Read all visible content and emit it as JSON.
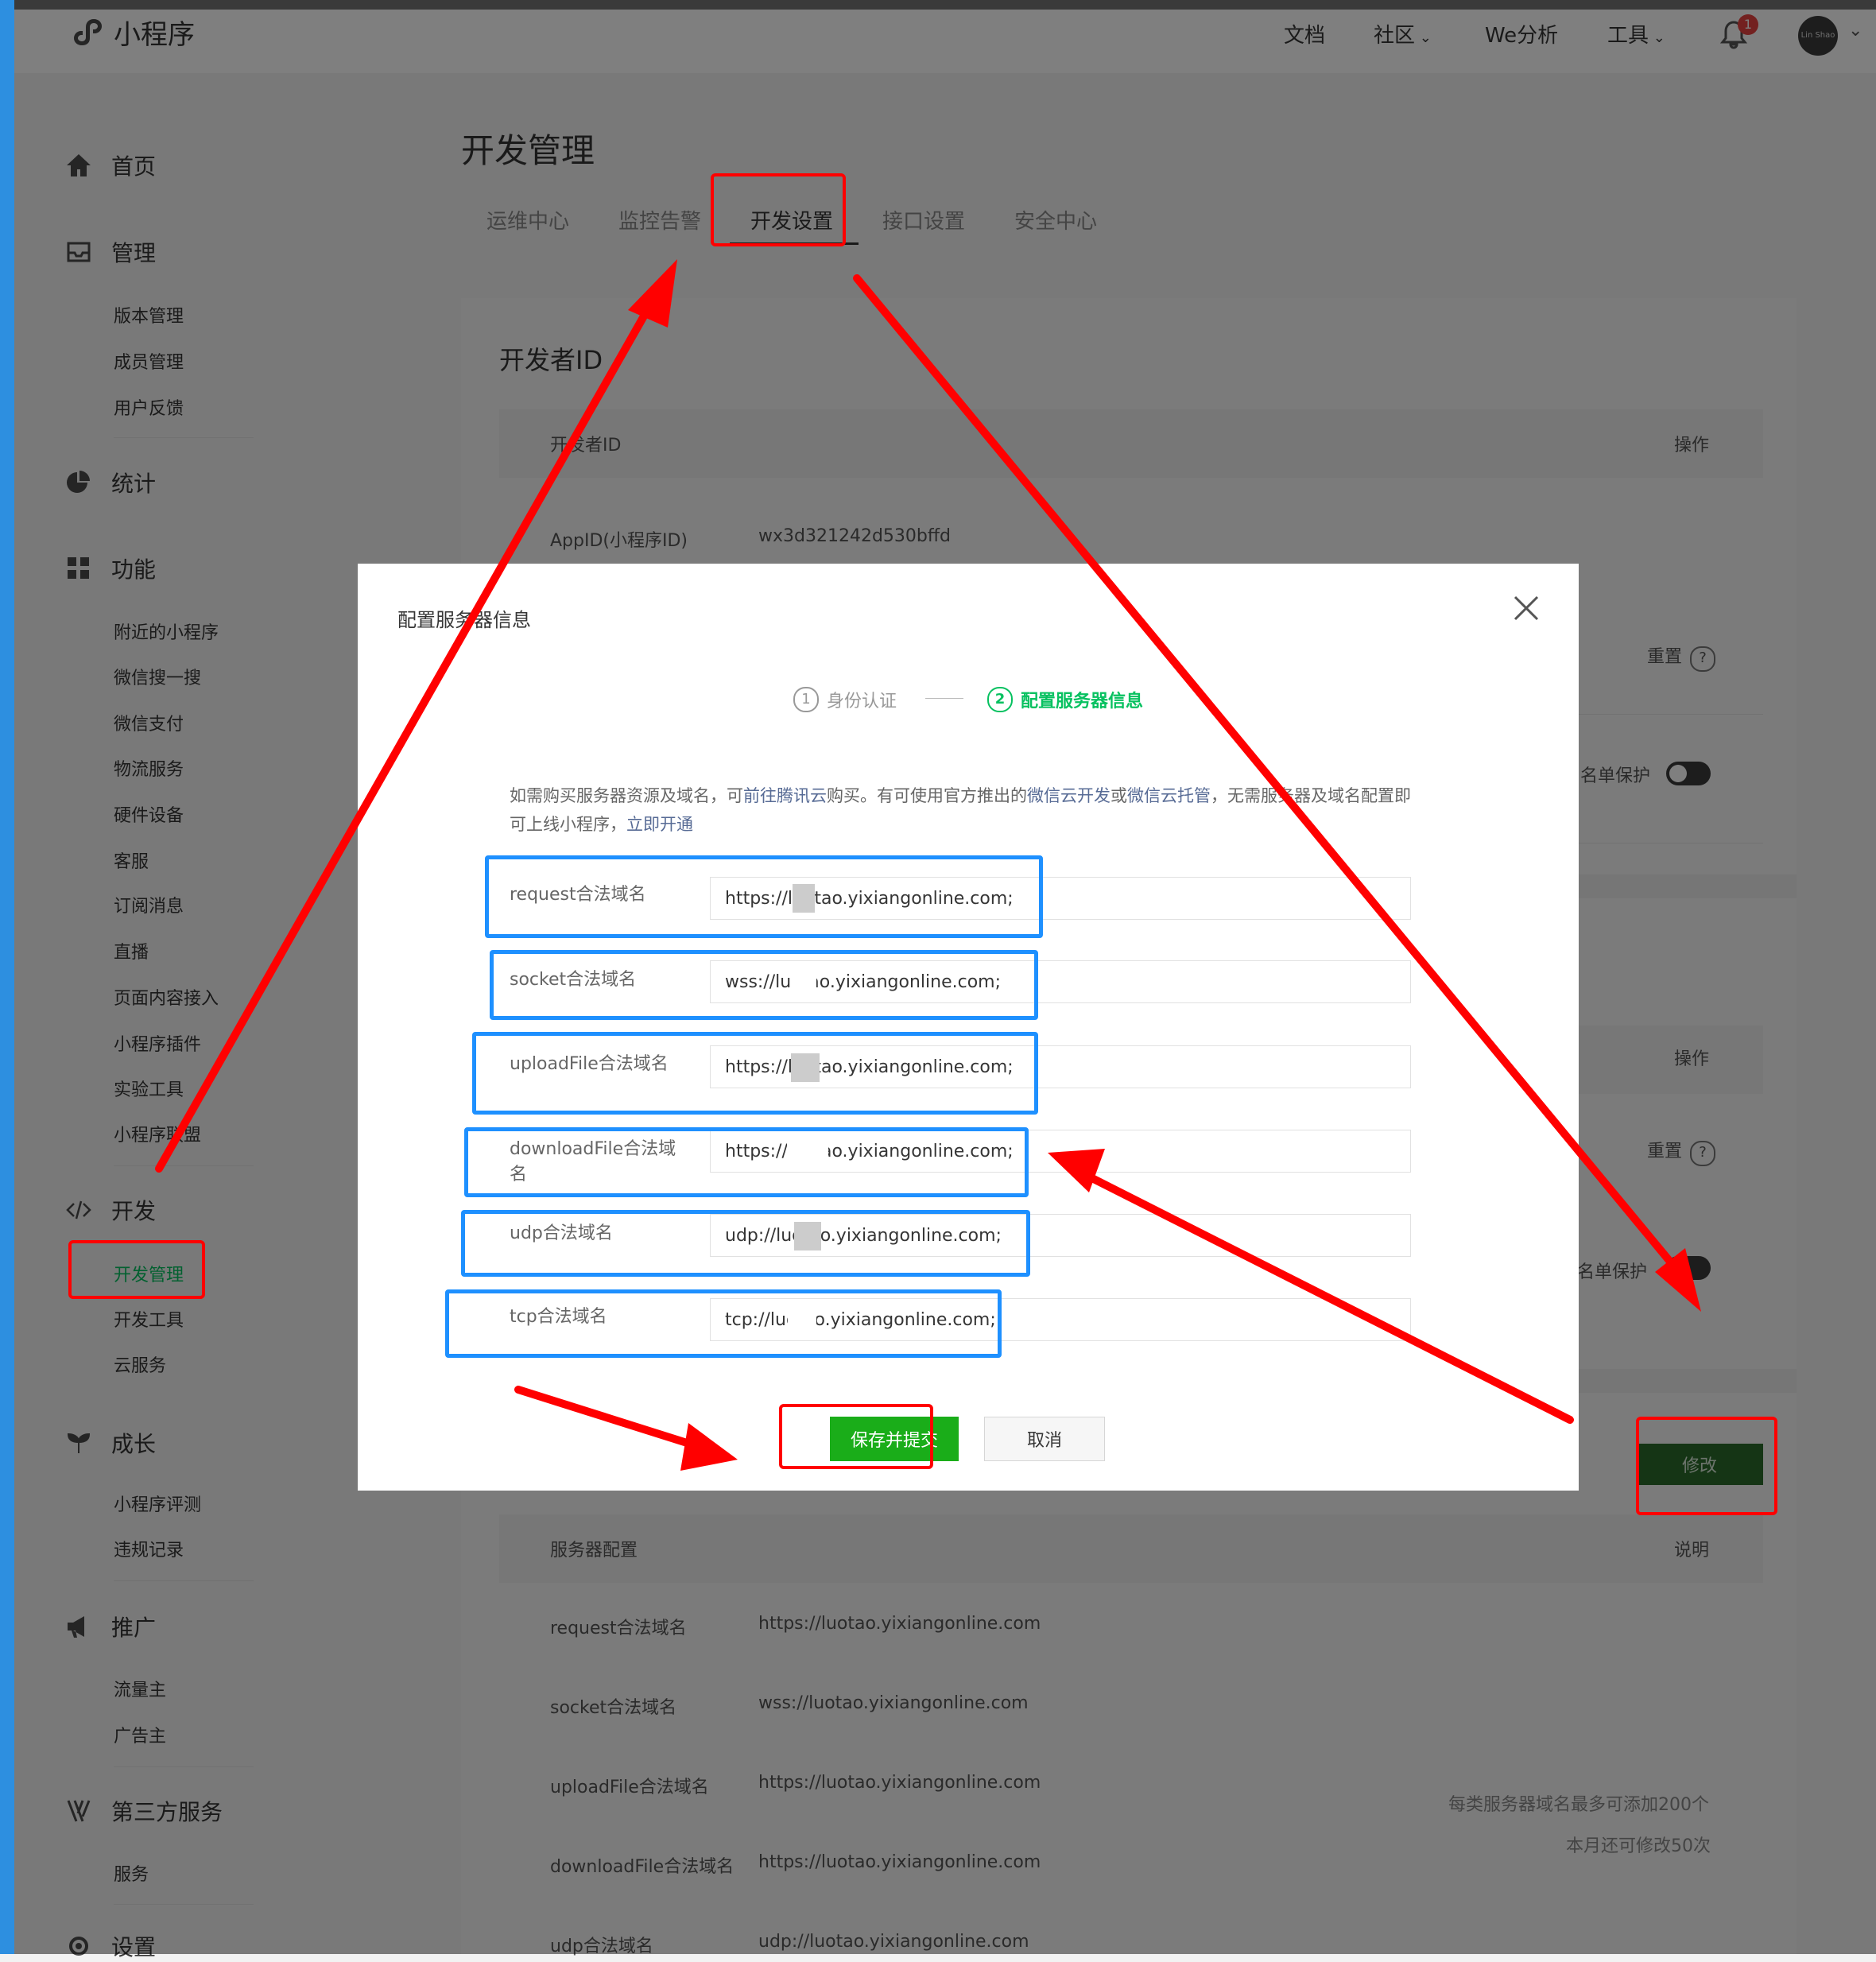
{
  "header": {
    "logo_text": "小程序",
    "nav": [
      "文档",
      "社区",
      "We分析",
      "工具"
    ],
    "notification_count": "1",
    "avatar_text": "Lin Shao"
  },
  "sidebar": {
    "home": "首页",
    "manage": {
      "title": "管理",
      "items": [
        "版本管理",
        "成员管理",
        "用户反馈"
      ]
    },
    "stats": "统计",
    "features": {
      "title": "功能",
      "items": [
        "附近的小程序",
        "微信搜一搜",
        "微信支付",
        "物流服务",
        "硬件设备",
        "客服",
        "订阅消息",
        "直播",
        "页面内容接入",
        "小程序插件",
        "实验工具",
        "小程序联盟"
      ]
    },
    "dev": {
      "title": "开发",
      "items": [
        "开发管理",
        "开发工具",
        "云服务"
      ]
    },
    "growth": {
      "title": "成长",
      "items": [
        "小程序评测",
        "违规记录"
      ]
    },
    "promo": {
      "title": "推广",
      "items": [
        "流量主",
        "广告主"
      ]
    },
    "third": {
      "title": "第三方服务",
      "items": [
        "服务"
      ]
    },
    "settings": "设置"
  },
  "main": {
    "title": "开发管理",
    "tabs": [
      "运维中心",
      "监控告警",
      "开发设置",
      "接口设置",
      "安全中心"
    ],
    "dev_id_title": "开发者ID",
    "table_header_col1": "开发者ID",
    "table_header_op": "操作",
    "appid_label": "AppID(小程序ID)",
    "appid_value": "wx3d321242d530bffd",
    "reset": "重置",
    "whitelist_protect": "名单保护",
    "op2": "操作",
    "modify_btn": "修改",
    "server_table_header": "服务器配置",
    "server_table_note_header": "说明",
    "server_rows": [
      {
        "label": "request合法域名",
        "value": "https://luotao.yixiangonline.com"
      },
      {
        "label": "socket合法域名",
        "value": "wss://luotao.yixiangonline.com"
      },
      {
        "label": "uploadFile合法域名",
        "value": "https://luotao.yixiangonline.com"
      },
      {
        "label": "downloadFile合法域名",
        "value": "https://luotao.yixiangonline.com"
      },
      {
        "label": "udp合法域名",
        "value": "udp://luotao.yixiangonline.com"
      }
    ],
    "limit_note_1": "每类服务器域名最多可添加200个",
    "limit_note_2": "本月还可修改50次"
  },
  "modal": {
    "title": "配置服务器信息",
    "step1_num": "1",
    "step1": "身份认证",
    "step2_num": "2",
    "step2": "配置服务器信息",
    "notice_pre": "如需购买服务器资源及域名，可",
    "notice_link1": "前往腾讯云",
    "notice_mid1": "购买。有可使用官方推出的",
    "notice_link2": "微信云开发",
    "notice_mid2": "或",
    "notice_link3": "微信云托管",
    "notice_mid3": "，无需服务器及域名配置即可上线小程序，",
    "notice_link4": "立即开通",
    "fields": [
      {
        "label": "request合法域名",
        "value": "https://luotao.yixiangonline.com;"
      },
      {
        "label": "socket合法域名",
        "value": "wss://luotao.yixiangonline.com;"
      },
      {
        "label": "uploadFile合法域名",
        "value": "https://luotao.yixiangonline.com;"
      },
      {
        "label": "downloadFile合法域名",
        "value": "https://luotao.yixiangonline.com;"
      },
      {
        "label": "udp合法域名",
        "value": "udp://luotao.yixiangonline.com;"
      },
      {
        "label": "tcp合法域名",
        "value": "tcp://luotao.yixiangonline.com;"
      }
    ],
    "save_btn": "保存并提交",
    "cancel_btn": "取消"
  },
  "colors": {
    "brand_green": "#07c160",
    "annotation_red": "#ff0000",
    "annotation_blue": "#1e90ff"
  }
}
